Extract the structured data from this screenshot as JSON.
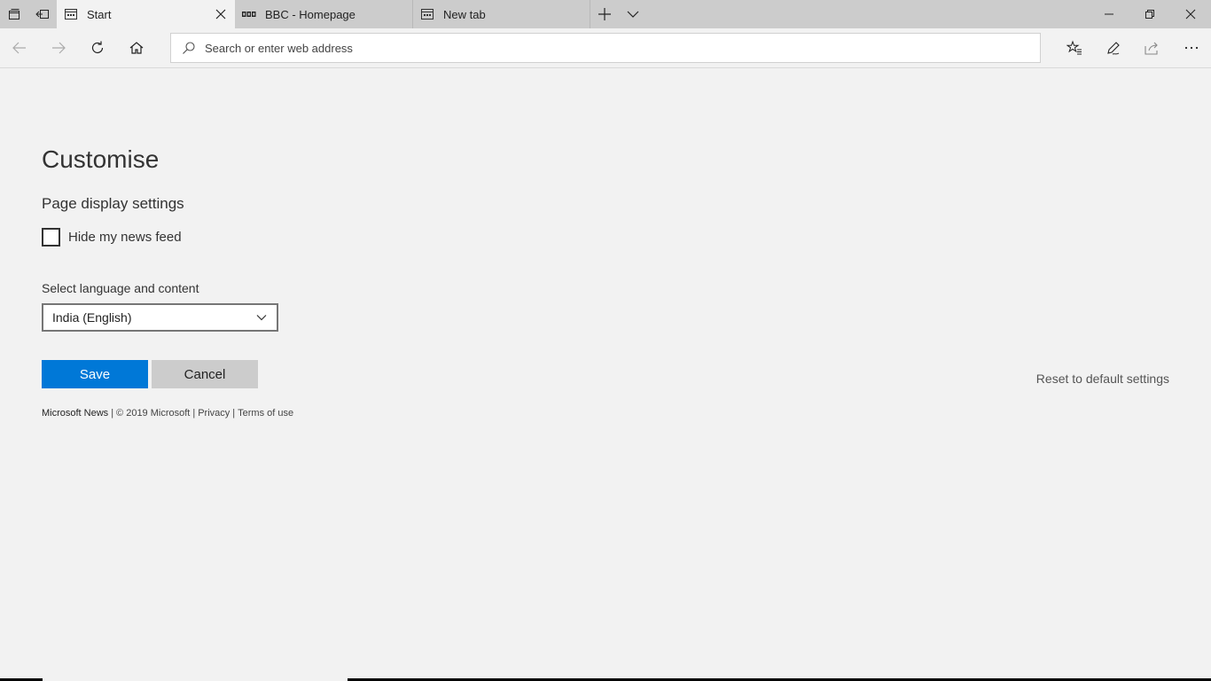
{
  "tabs": [
    {
      "title": "Start",
      "active": true
    },
    {
      "title": "BBC - Homepage",
      "active": false
    },
    {
      "title": "New tab",
      "active": false
    }
  ],
  "addressbar": {
    "placeholder": "Search or enter web address"
  },
  "page": {
    "title": "Customise",
    "section_title": "Page display settings",
    "checkbox_label": "Hide my news feed",
    "checkbox_checked": false,
    "language_label": "Select language and content",
    "language_value": "India (English)",
    "save_label": "Save",
    "cancel_label": "Cancel",
    "reset_label": "Reset to default settings"
  },
  "footer": {
    "brand": "Microsoft News",
    "copyright": "© 2019 Microsoft",
    "privacy": "Privacy",
    "terms": "Terms of use",
    "separator": "|"
  },
  "colors": {
    "accent": "#0078d7",
    "tabbar": "#cccccc",
    "background": "#f2f2f2"
  },
  "icons": [
    "tab-set-aside-icon",
    "tabs-preview-icon",
    "page-icon",
    "bbc-icon",
    "close-icon",
    "new-tab-plus-icon",
    "chevron-down-icon",
    "minimize-icon",
    "restore-icon",
    "window-close-icon",
    "back-arrow-icon",
    "forward-arrow-icon",
    "refresh-icon",
    "home-icon",
    "search-icon",
    "favorites-icon",
    "pen-icon",
    "share-icon",
    "more-icon"
  ]
}
